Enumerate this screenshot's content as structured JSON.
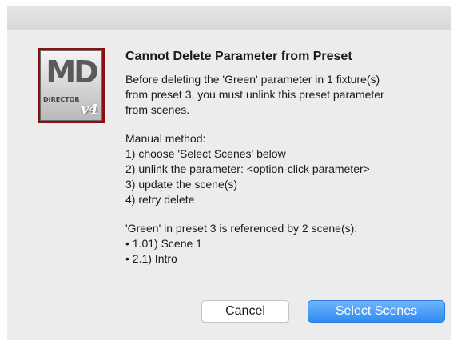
{
  "dialog": {
    "title": "Cannot Delete Parameter from Preset",
    "paragraph1": "Before deleting the 'Green' parameter in 1 fixture(s)\nfrom preset 3, you must unlink this preset parameter\nfrom scenes.",
    "paragraph2": "Manual method:\n  1) choose 'Select Scenes' below\n  2) unlink the parameter: <option-click parameter>\n  3) update the scene(s)\n  4) retry delete",
    "paragraph3": "'Green' in preset 3 is referenced by 2 scene(s):\n• 1.01) Scene 1\n• 2.1) Intro",
    "buttons": {
      "cancel": "Cancel",
      "select_scenes": "Select Scenes"
    }
  },
  "app_icon": {
    "name": "md-director-v4-icon",
    "logo_text": "MD",
    "sub_text": "DIRECTOR",
    "version_text": "v4"
  },
  "colors": {
    "dialog_background": "#ececec",
    "primary_button": "#3a8ef6",
    "icon_border": "#8a1010"
  }
}
